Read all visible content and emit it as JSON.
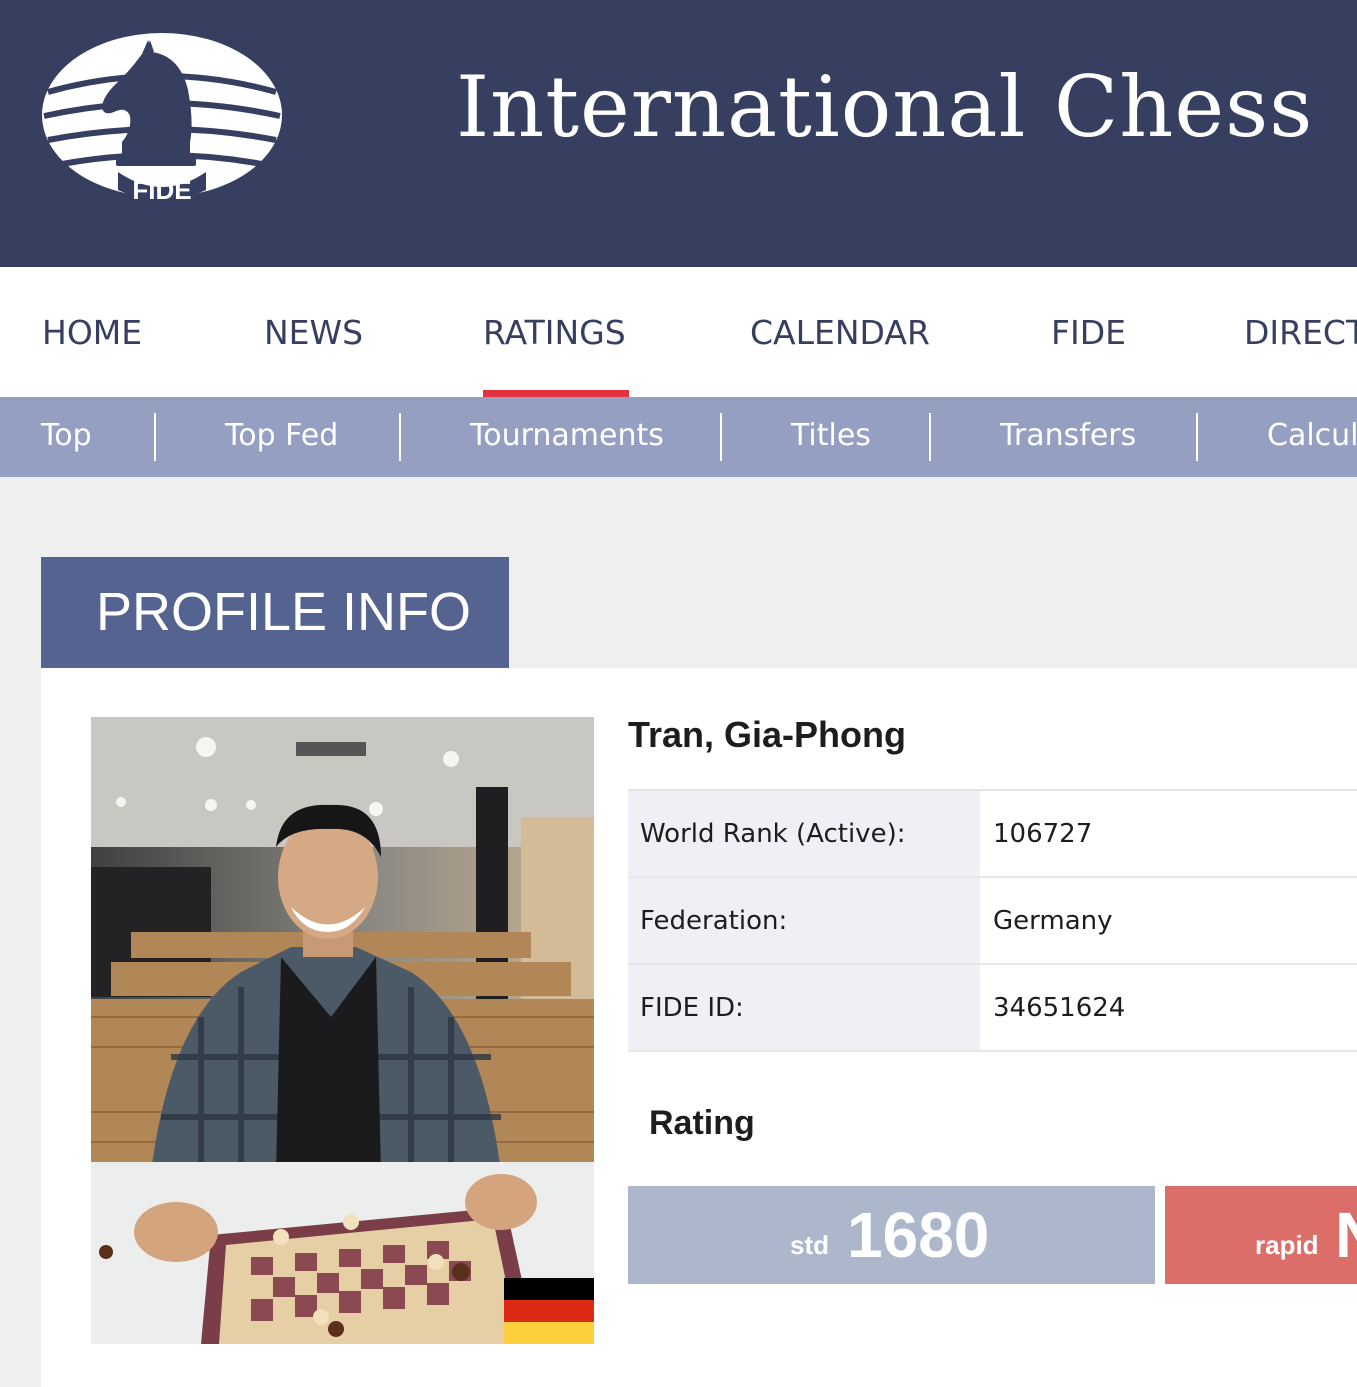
{
  "header": {
    "logo_text": "FIDE",
    "site_title": "International Chess"
  },
  "main_nav": {
    "items": [
      {
        "label": "HOME"
      },
      {
        "label": "NEWS"
      },
      {
        "label": "RATINGS",
        "active": true
      },
      {
        "label": "CALENDAR"
      },
      {
        "label": "FIDE"
      },
      {
        "label": "DIRECT"
      }
    ]
  },
  "sub_nav": {
    "items": [
      {
        "label": "Top"
      },
      {
        "label": "Top Fed"
      },
      {
        "label": "Tournaments"
      },
      {
        "label": "Titles"
      },
      {
        "label": "Transfers"
      },
      {
        "label": "Calcul"
      }
    ]
  },
  "profile": {
    "section_title": "PROFILE INFO",
    "name": "Tran, Gia-Phong",
    "flag_colors": [
      "#000000",
      "#dd2a15",
      "#fdcf3c"
    ],
    "info": [
      {
        "label": "World Rank (Active):",
        "value": "106727"
      },
      {
        "label": "Federation:",
        "value": "Germany"
      },
      {
        "label": "FIDE ID:",
        "value": "34651624"
      }
    ],
    "rating_heading": "Rating",
    "ratings": {
      "std": {
        "kind": "std",
        "value": "1680"
      },
      "rapid": {
        "kind": "rapid",
        "value": "N"
      }
    }
  },
  "colors": {
    "header_bg": "#373f61",
    "accent_red": "#e3323f",
    "subnav_bg": "#959fc2",
    "profile_tab_bg": "#546390",
    "std_bg": "#adb7cb",
    "rapid_bg": "#dc6e69"
  }
}
